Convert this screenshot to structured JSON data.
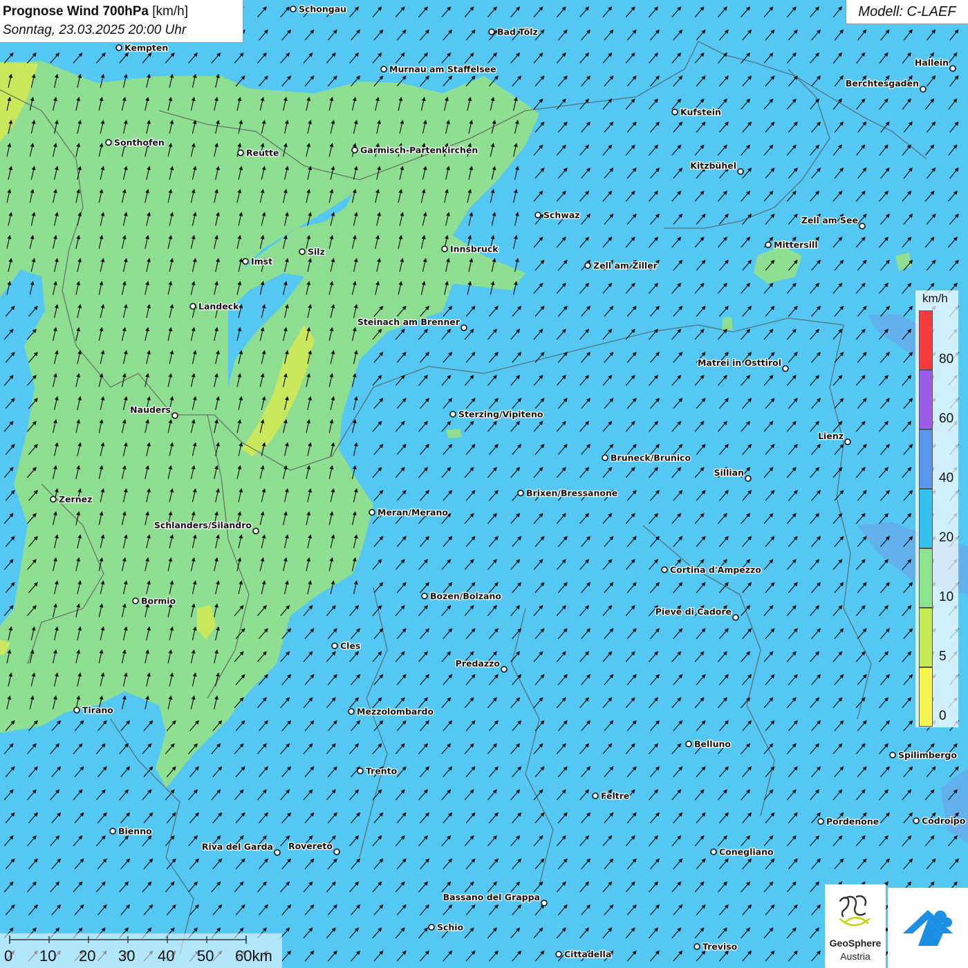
{
  "title": {
    "main": "Prognose Wind 700hPa",
    "unit": " [km/h]",
    "datetime": "Sonntag, 23.03.2025 20:00 Uhr"
  },
  "model": "Modell: C-LAEF",
  "legend": {
    "unit": "km/h",
    "classes": [
      {
        "label": "80",
        "color": "#f53b3b"
      },
      {
        "label": "60",
        "color": "#9b5de8"
      },
      {
        "label": "40",
        "color": "#5c95ee"
      },
      {
        "label": "20",
        "color": "#33c1ef"
      },
      {
        "label": "10",
        "color": "#8ee38f"
      },
      {
        "label": "5",
        "color": "#c4ec52"
      },
      {
        "label": "0",
        "color": "#f6f54f"
      }
    ]
  },
  "scale": {
    "labels": [
      "0",
      "10",
      "20",
      "30",
      "40",
      "50",
      "60km"
    ]
  },
  "logos": {
    "geosphere_name": "GeoSphere",
    "geosphere_sub": "Austria"
  },
  "cities": [
    "Schongau",
    "Bad Tölz",
    "Kempten",
    "Murnau am Staffelsee",
    "Hallein",
    "Berchtesgaden",
    "Kufstein",
    "Sonthofen",
    "Reutte",
    "Garmisch-Partenkirchen",
    "Kitzbühel",
    "Schwaz",
    "Zell am See",
    "Mittersill",
    "Innsbruck",
    "Imst",
    "Silz",
    "Zell am Ziller",
    "Landeck",
    "Steinach am Brenner",
    "Matrei in Osttirol",
    "Nauders",
    "Sterzing/Vipiteno",
    "Lienz",
    "Bruneck/Brunico",
    "Sillian",
    "Brixen/Bressanone",
    "Zernez",
    "Meran/Merano",
    "Schlanders/Silandro",
    "Cortina d'Ampezzo",
    "Bozen/Bolzano",
    "Bormio",
    "Pieve di Cadore",
    "Cles",
    "Predazzo",
    "Tirano",
    "Mezzolombardo",
    "Belluno",
    "Spilimbergo",
    "Trento",
    "Feltre",
    "Pordenone",
    "Codroipo",
    "Bienno",
    "Riva del Garda",
    "Rovereto",
    "Conegliano",
    "Bassano del Grappa",
    "Schio",
    "Treviso",
    "Cittadella"
  ],
  "colors": {
    "wind_10_20": "#54c8f3",
    "wind_5_10": "#92e08c",
    "wind_0_5": "#cfe85a",
    "wind_20_40": "#6d9ee8"
  },
  "icons": [
    "wind-arrow-icon",
    "city-marker-icon",
    "geosphere-logo-icon",
    "cloud-logo-icon"
  ]
}
